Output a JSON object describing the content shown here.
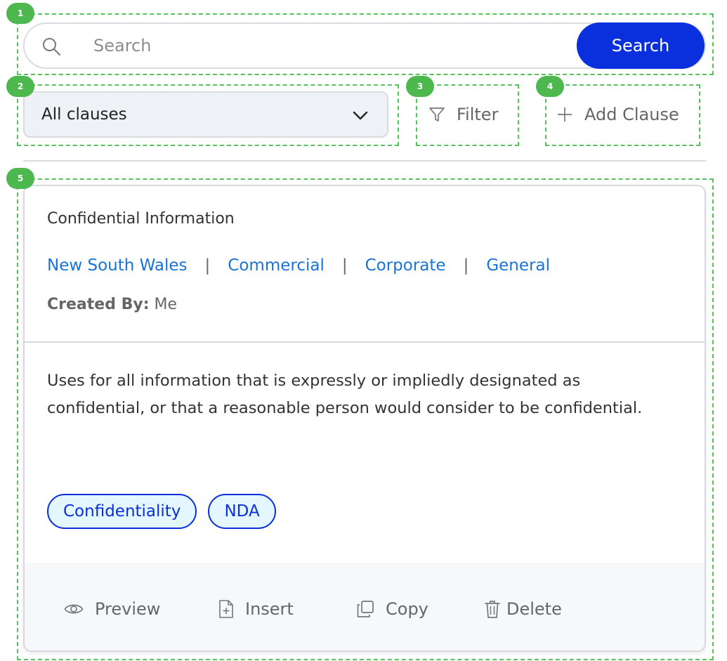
{
  "search": {
    "placeholder": "Search",
    "button_label": "Search"
  },
  "controls": {
    "dropdown": {
      "selected": "All clauses"
    },
    "filter_label": "Filter",
    "add_label": "Add Clause"
  },
  "markers": [
    "1",
    "2",
    "3",
    "4",
    "5"
  ],
  "clause": {
    "title": "Confidential Information",
    "jurisdictions": [
      "New South Wales",
      "Commercial",
      "Corporate",
      "General"
    ],
    "separator": "|",
    "created_by_label": "Created By:",
    "created_by_value": "Me",
    "description": "Uses for all information that is expressly or impliedly designated as confidential, or that a reasonable person would consider to be confidential.",
    "tags": [
      "Confidentiality",
      "NDA"
    ],
    "actions": {
      "preview": "Preview",
      "insert": "Insert",
      "copy": "Copy",
      "delete": "Delete"
    }
  },
  "colors": {
    "accent": "#0a2fdc",
    "link": "#1a73d9",
    "tag_bg": "#e4f6ff",
    "marker": "#4cb84e"
  }
}
